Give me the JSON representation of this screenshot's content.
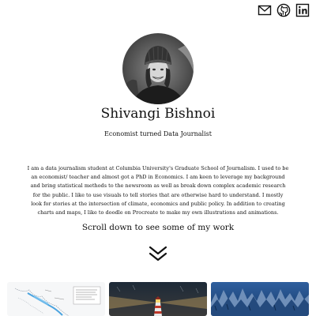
{
  "social": {
    "email_icon": "envelope-icon",
    "github_icon": "github-icon",
    "linkedin_icon": "linkedin-icon"
  },
  "profile": {
    "name": "Shivangi Bishnoi",
    "tagline": "Economist turned Data Journalist",
    "bio": "I am a data journalism student at Columbia University's Graduate School of Journalism. I used to be an economist/ teacher and almost got a PhD in Economics. I am keen to leverage my background and bring statistical methods to the newsroom as well as break down complex academic research for the public. I like to use visuals to tell stories that are otherwise hard to understand. I mostly look for stories at the intersection of climate, economics and public policy. In addition to creating charts and maps, I like to doodle on Procreate to make my own illustrations and animations."
  },
  "portfolio": {
    "scroll_prompt": "Scroll down to see some of my work",
    "chevron_icon": "double-chevron-down-icon"
  },
  "colors": {
    "text": "#111111",
    "background": "#ffffff"
  }
}
